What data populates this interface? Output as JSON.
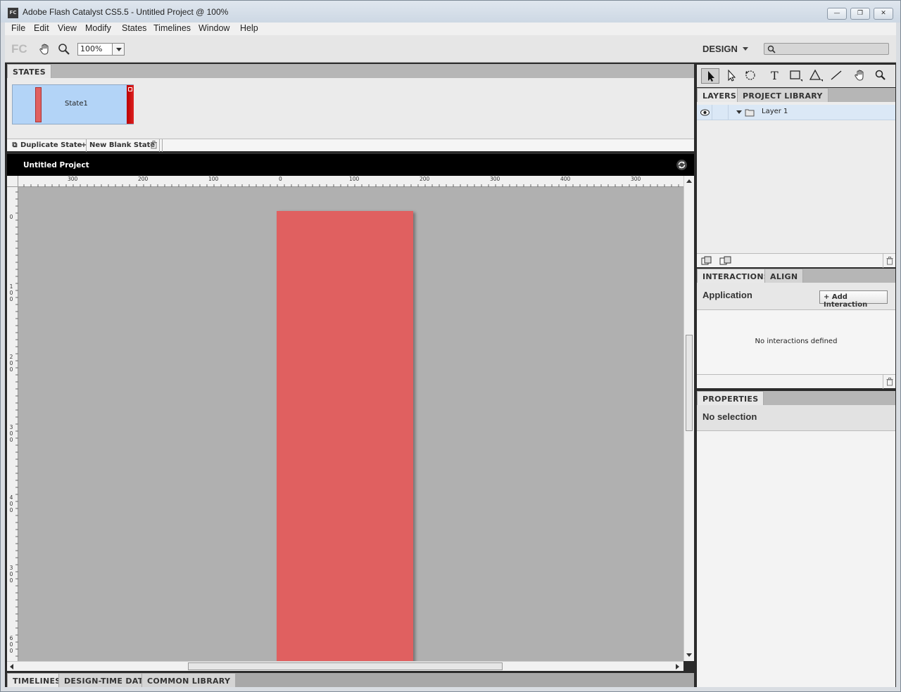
{
  "window": {
    "title": "Adobe Flash Catalyst CS5.5 - Untitled Project @ 100%",
    "app_icon_text": "FC"
  },
  "menu": [
    "File",
    "Edit",
    "View",
    "Modify",
    "States",
    "Timelines",
    "Window",
    "Help"
  ],
  "toolbar": {
    "logo": "FC",
    "zoom_value": "100%",
    "workspace": "DESIGN",
    "search_placeholder": ""
  },
  "states": {
    "tab": "STATES",
    "items": [
      {
        "label": "State1"
      }
    ],
    "duplicate_label": "Duplicate State",
    "new_blank_label": "New Blank State"
  },
  "document": {
    "title": "Untitled Project"
  },
  "rulers": {
    "top_labels": [
      "300",
      "200",
      "100",
      "0",
      "100",
      "200",
      "300",
      "400",
      "300"
    ],
    "left_labels": [
      "0",
      "100",
      "200",
      "300",
      "400",
      "300",
      "600"
    ]
  },
  "bottom_tabs": [
    "TIMELINES",
    "DESIGN-TIME DATA",
    "COMMON LIBRARY"
  ],
  "layers": {
    "tabs": [
      "LAYERS",
      "PROJECT LIBRARY"
    ],
    "items": [
      {
        "label": "Layer 1"
      }
    ]
  },
  "interactions": {
    "tabs": [
      "INTERACTIONS",
      "ALIGN"
    ],
    "target": "Application",
    "add_label": "Add Interaction",
    "empty_text": "No interactions defined"
  },
  "properties": {
    "tab": "PROPERTIES",
    "status": "No selection"
  },
  "colors": {
    "artboard_rect": "#e06060",
    "state_thumb_bg": "#b3d4f7",
    "canvas_bg": "#b0b0b0"
  }
}
